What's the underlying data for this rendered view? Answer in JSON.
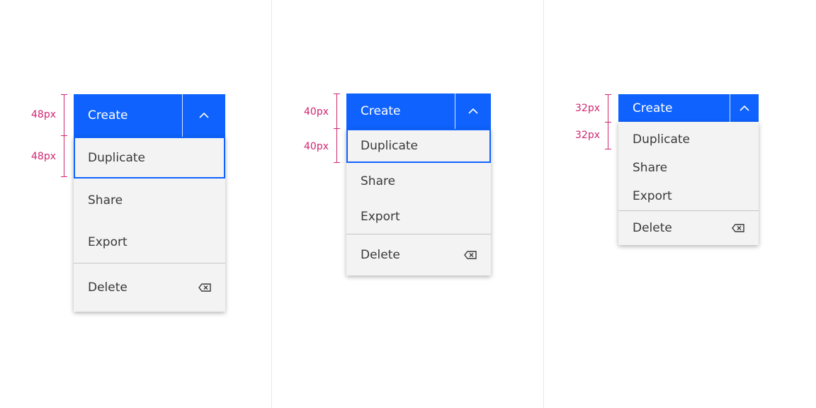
{
  "variants": [
    {
      "size_label": "48px",
      "button_label": "Create",
      "items": [
        "Duplicate",
        "Share",
        "Export"
      ],
      "danger_item": "Delete",
      "focused_item": "Duplicate"
    },
    {
      "size_label": "40px",
      "button_label": "Create",
      "items": [
        "Duplicate",
        "Share",
        "Export"
      ],
      "danger_item": "Delete",
      "focused_item": "Duplicate"
    },
    {
      "size_label": "32px",
      "button_label": "Create",
      "items": [
        "Duplicate",
        "Share",
        "Export"
      ],
      "danger_item": "Delete",
      "focused_item": null
    }
  ],
  "colors": {
    "primary": "#0f62fe",
    "annotation": "#d02670",
    "menu_bg": "#f3f3f3"
  }
}
